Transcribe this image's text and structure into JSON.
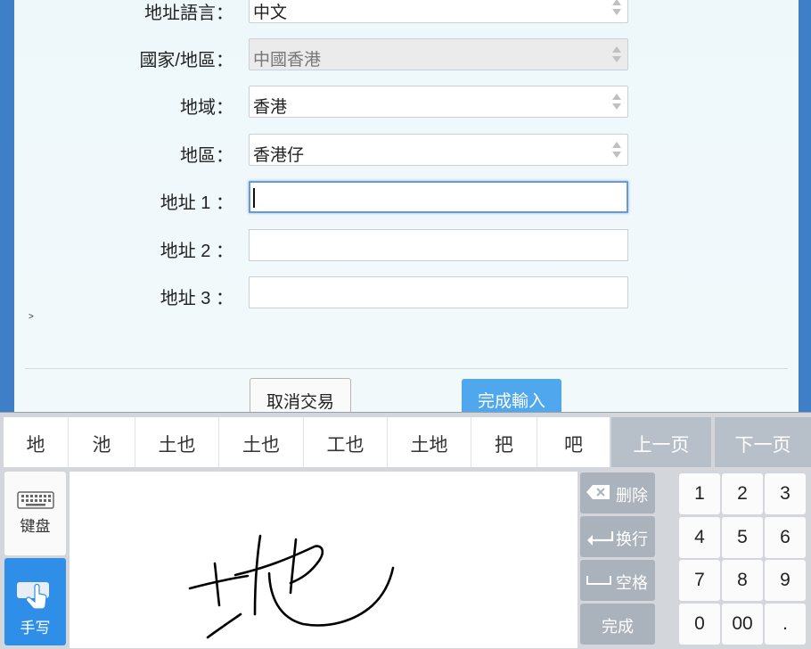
{
  "form": {
    "fields": [
      {
        "label": "地址語言：",
        "value": "中文"
      },
      {
        "label": "國家/地區：",
        "value": "中國香港"
      },
      {
        "label": "地域：",
        "value": "香港"
      },
      {
        "label": "地區：",
        "value": "香港仔"
      },
      {
        "label": "地址 1 ：",
        "value": ""
      },
      {
        "label": "地址 2 ：",
        "value": ""
      },
      {
        "label": "地址 3 ：",
        "value": ""
      }
    ],
    "cancel_label": "取消交易",
    "complete_label": "完成輸入",
    "stray_mark": ">"
  },
  "ime": {
    "candidates": [
      "地",
      "池",
      "土也",
      "土也",
      "工也",
      "土地",
      "把",
      "吧"
    ],
    "prev_page": "上一页",
    "next_page": "下一页",
    "keyboard_mode": "键盘",
    "handwrite_mode": "手写",
    "delete_label": "删除",
    "newline_label": "换行",
    "space_label": "空格",
    "done_label": "完成",
    "numpad": [
      "1",
      "2",
      "3",
      "4",
      "5",
      "6",
      "7",
      "8",
      "9",
      "0",
      "00",
      "."
    ],
    "icons": {
      "keyboard": "keyboard-icon",
      "handwrite": "handwrite-icon",
      "delete": "backspace-icon",
      "newline": "enter-icon",
      "space": "space-icon"
    }
  },
  "colors": {
    "accent": "#4fa7ee",
    "handwrite_active": "#2f8ee8",
    "function_key": "#aab2bb",
    "page_button": "#b7bfc8",
    "outer_background": "#3f7fc7"
  }
}
